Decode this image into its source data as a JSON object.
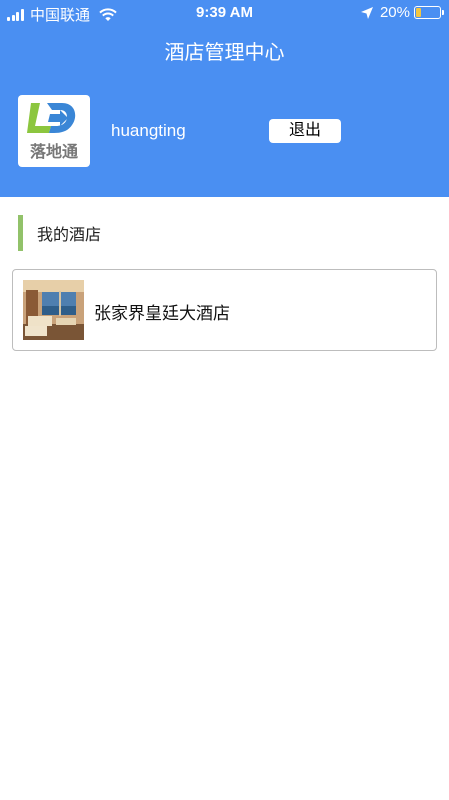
{
  "status_bar": {
    "carrier": "中国联通",
    "time": "9:39 AM",
    "battery_text": "20%",
    "battery_level": 0.2
  },
  "header": {
    "title": "酒店管理中心",
    "logo_text": "落地通",
    "username": "huangting",
    "logout_label": "退出"
  },
  "section": {
    "title": "我的酒店"
  },
  "hotels": [
    {
      "name": "张家界皇廷大酒店"
    }
  ],
  "colors": {
    "header_bg": "#4a8ff2",
    "accent_bar": "#92c26a",
    "logo_green": "#8cc63f",
    "logo_blue": "#3a86d6"
  }
}
